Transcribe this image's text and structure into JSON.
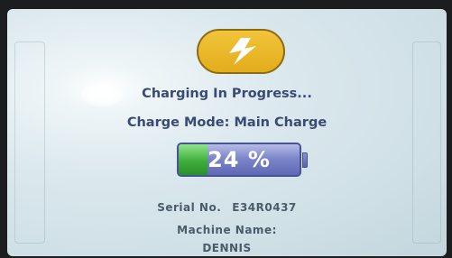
{
  "header": {
    "icon": "lightning-bolt-icon",
    "accent_color": "#e9b626"
  },
  "status": {
    "title": "Charging In Progress...",
    "charge_mode_label": "Charge Mode:",
    "charge_mode_value": "Main Charge"
  },
  "battery": {
    "percent_text": "24 %",
    "level_percent": 24,
    "fill_color": "#3fae3c",
    "body_color": "#7d86c9"
  },
  "machine": {
    "serial_label": "Serial No.",
    "serial_value": "E34R0437",
    "name_label": "Machine Name:",
    "name_value": "DENNIS"
  }
}
